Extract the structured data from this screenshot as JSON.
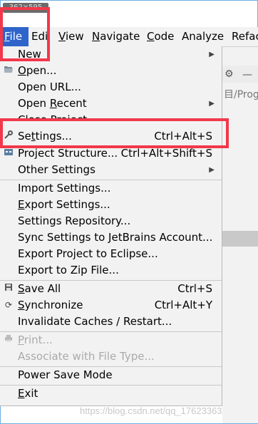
{
  "window": {
    "title_chip": "362×595"
  },
  "menubar": {
    "items": [
      {
        "mnemonic": "F",
        "rest": "ile"
      },
      {
        "mnemonic": "",
        "rest": "Edi"
      },
      {
        "mnemonic": "V",
        "rest": "iew"
      },
      {
        "mnemonic": "N",
        "rest": "avigate"
      },
      {
        "mnemonic": "C",
        "rest": "ode"
      },
      {
        "mnemonic": "",
        "rest": "Analyze"
      },
      {
        "mnemonic": "",
        "rest": "Refac"
      }
    ]
  },
  "background": {
    "path_fragment": "目/Progr"
  },
  "file_menu": {
    "new": "New",
    "open_mn": "O",
    "open_rest": "pen...",
    "open_url": "Open URL...",
    "open_recent_a": "Open ",
    "open_recent_mn": "R",
    "open_recent_b": "ecent",
    "close_project": "Close Project",
    "settings_a": "Se",
    "settings_mn": "t",
    "settings_b": "tings...",
    "settings_shortcut": "Ctrl+Alt+S",
    "project_structure": "Project Structure...",
    "project_structure_shortcut": "Ctrl+Alt+Shift+S",
    "other_settings": "Other Settings",
    "import_settings": "Import Settings...",
    "export_a": "E",
    "export_b": "xport Settings...",
    "settings_repository": "Settings Repository...",
    "sync_settings": "Sync Settings to JetBrains Account...",
    "export_eclipse": "Export Project to Eclipse...",
    "export_zip": "Export to Zip File...",
    "save_all_mn": "S",
    "save_all_rest": "ave All",
    "save_all_shortcut": "Ctrl+S",
    "sync_mn": "S",
    "sync_rest": "ynchronize",
    "sync_shortcut": "Ctrl+Alt+Y",
    "invalidate": "Invalidate Caches / Restart...",
    "print_mn": "P",
    "print_rest": "rint...",
    "associate": "Associate with File Type...",
    "power_save": "Power Save Mode",
    "exit_mn": "E",
    "exit_rest": "xit"
  },
  "watermark": "https://blog.csdn.net/qq_17623363",
  "colors": {
    "highlight_box": "#f2384a",
    "menu_active": "#2f65ca"
  }
}
